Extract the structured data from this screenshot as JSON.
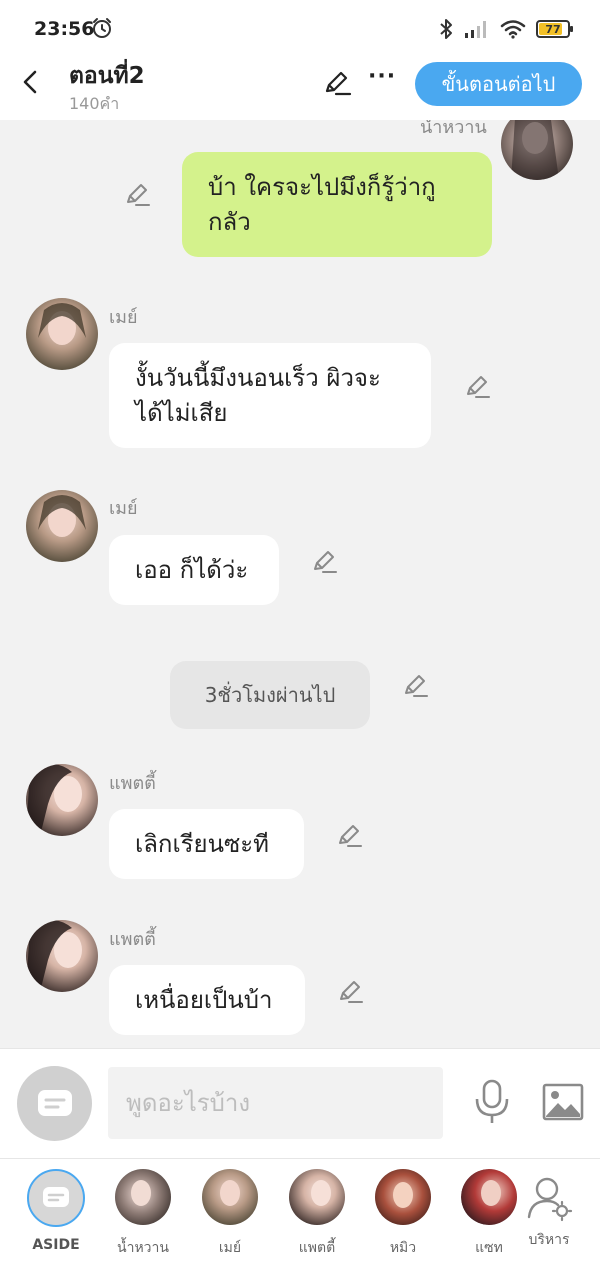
{
  "status_bar": {
    "time": "23:56",
    "battery": "77"
  },
  "header": {
    "title": "ตอนที่2",
    "subtitle": "140คำ",
    "next_button": "ขั้นตอนต่อไป"
  },
  "messages": [
    {
      "sender": "น้ำหวาน",
      "text": "บ้า ใครจะไปมึงก็รู้ว่ากู\nกลัว",
      "side": "right"
    },
    {
      "sender": "เมย์",
      "text": "งั้นวันนี้มึงนอนเร็ว ผิวจะ\nได้ไม่เสีย",
      "side": "left"
    },
    {
      "sender": "เมย์",
      "text": "เออ ก็ได้ว่ะ",
      "side": "left"
    },
    {
      "system": "3ชั่วโมงผ่านไป"
    },
    {
      "sender": "แพตตี้",
      "text": "เลิกเรียนซะที",
      "side": "left"
    },
    {
      "sender": "แพตตี้",
      "text": "เหนื่อยเป็นบ้า",
      "side": "left"
    }
  ],
  "composer": {
    "placeholder": "พูดอะไรบ้าง"
  },
  "characters": [
    {
      "label": "ASIDE"
    },
    {
      "label": "น้ำหวาน"
    },
    {
      "label": "เมย์"
    },
    {
      "label": "แพตตี้"
    },
    {
      "label": "หมิว"
    },
    {
      "label": "แซท"
    },
    {
      "label": "บริหาร"
    }
  ],
  "colors": {
    "accent": "#4aa8f0",
    "my_bubble": "#d4f28c",
    "background": "#f2f2f2"
  }
}
